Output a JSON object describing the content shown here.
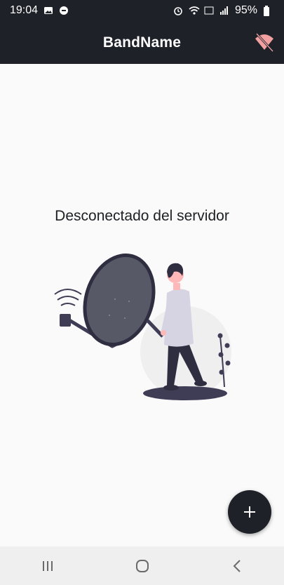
{
  "status_bar": {
    "time": "19:04",
    "battery": "95%",
    "icons": [
      "gallery-icon",
      "notification-icon",
      "alarm-icon",
      "wifi-icon",
      "volte-icon",
      "signal-icon",
      "battery-icon"
    ]
  },
  "app_bar": {
    "title": "BandName",
    "action_icon": "wifi-off-icon",
    "action_color": "#f2a0a0"
  },
  "main": {
    "message": "Desconectado del servidor",
    "illustration": "disconnected-satellite-dish-illustration"
  },
  "fab": {
    "icon": "plus-icon",
    "symbol": "+"
  },
  "nav_bar": {
    "icons": [
      "recents-icon",
      "home-icon",
      "back-icon"
    ]
  },
  "colors": {
    "primary_dark": "#1f2129",
    "background": "#fafafa",
    "accent_salmon": "#f2a0a0"
  }
}
